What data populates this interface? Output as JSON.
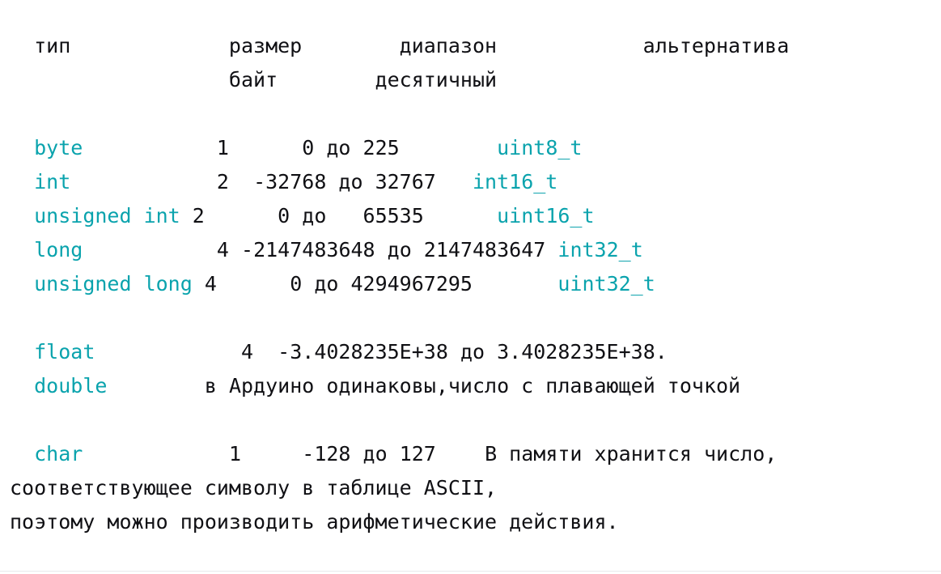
{
  "document": {
    "background_color": "#ffffff",
    "keyword_color": "#0aa3ad",
    "text_color": "#101014",
    "rule_color": "#e9e9ec"
  },
  "header": {
    "row1": {
      "col_type": "тип",
      "col_size": "размер",
      "col_range": "диапазон",
      "col_alt": "альтернатива",
      "full": "  тип             размер        диапазон            альтернатива"
    },
    "row2": {
      "col_size_unit": "байт",
      "col_range_unit": "десятичный",
      "full": "                  байт        десятичный"
    }
  },
  "integer_table": {
    "rows": [
      {
        "type": "byte",
        "size": "1",
        "range": "0 до 225",
        "alternative": "uint8_t",
        "line_prefix": "  ",
        "after_type": "           ",
        "after_size": "      ",
        "after_range": "        "
      },
      {
        "type": "int",
        "size": "2",
        "range": "-32768 до 32767",
        "alternative": "int16_t",
        "line_prefix": "  ",
        "after_type": "            ",
        "after_size": "  ",
        "after_range": "   "
      },
      {
        "type": "unsigned int",
        "size": "2",
        "range": "0 до   65535",
        "alternative": "uint16_t",
        "line_prefix": "  ",
        "after_type": " ",
        "after_size": "      ",
        "after_range": "      "
      },
      {
        "type": "long",
        "size": "4",
        "range": "-2147483648 до 2147483647",
        "alternative": "int32_t",
        "line_prefix": "  ",
        "after_type": "           ",
        "after_size": " ",
        "after_range": " "
      },
      {
        "type": "unsigned long",
        "size": "4",
        "range": "0 до 4294967295",
        "alternative": "uint32_t",
        "line_prefix": "  ",
        "after_type": " ",
        "after_size": "      ",
        "after_range": "       "
      }
    ]
  },
  "float_block": {
    "float": {
      "type": "float",
      "size": "4",
      "range": "-3.4028235E+38 до 3.4028235E+38.",
      "line_prefix": "  ",
      "after_type": "            ",
      "after_size": "  "
    },
    "double": {
      "type": "double",
      "note": "в Ардуино одинаковы,число с плавающей точкой",
      "line_prefix": "  ",
      "after_type": "        "
    }
  },
  "char_block": {
    "type": "char",
    "size": "1",
    "range": "-128 до 127",
    "note_inline": "В памяти хранится число,",
    "line_prefix": "  ",
    "after_type": "            ",
    "after_size": "     ",
    "after_range": "    ",
    "note_line2": "соответствующее символу в таблице ASCII,",
    "note_line3": "поэтому можно производить арифметические действия."
  },
  "rendered_lines": [
    "  тип             размер        диапазон            альтернатива",
    "                  байт        десятичный",
    "",
    "  byte           1         0 до 225           uint8_t",
    "  int            2     -32768 до 32767        int16_t",
    "  unsigned int 2         0 до   65535         uint16_t",
    "  long           4 -2147483648 до 2147483647 int32_t",
    "  unsigned long 4       0 до 4294967295       uint32_t",
    "",
    "  float            4  -3.4028235E+38 до 3.4028235E+38.",
    "  double         в Ардуино одинаковы,число с плавающей точкой",
    "",
    "  char             1     -128 до 127    В памяти хранится число,",
    "соответствующее символу в таблице ASCII,",
    "поэтому можно производить арифметические действия."
  ]
}
